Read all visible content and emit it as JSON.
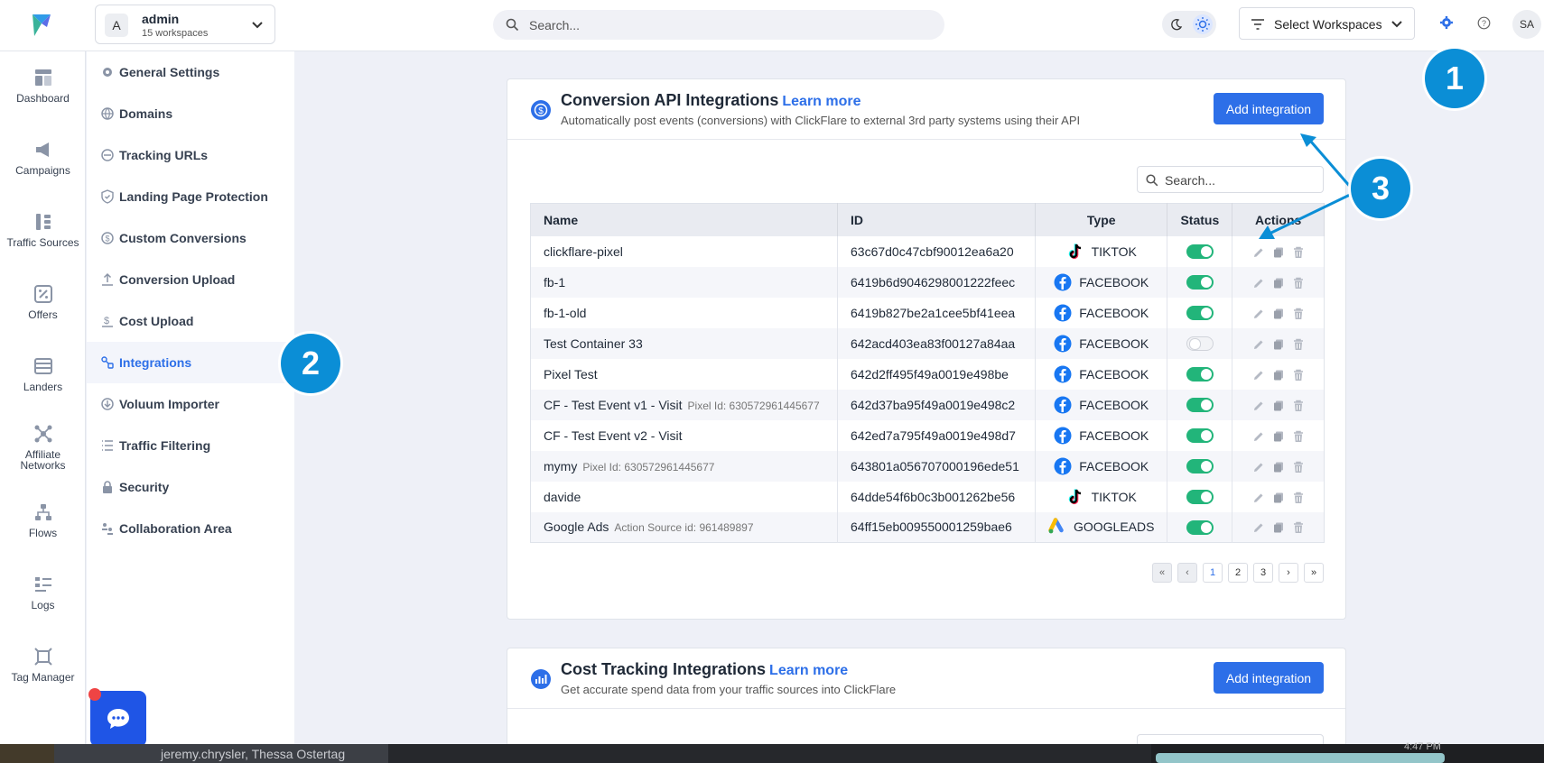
{
  "topbar": {
    "workspace": {
      "avatar": "A",
      "name": "admin",
      "sub": "15 workspaces"
    },
    "search_placeholder": "Search...",
    "select_workspaces_label": "Select Workspaces",
    "user_initials": "SA"
  },
  "leftnav": {
    "items": [
      {
        "label": "Dashboard",
        "icon": "dashboard-icon"
      },
      {
        "label": "Campaigns",
        "icon": "megaphone-icon"
      },
      {
        "label": "Traffic Sources",
        "icon": "traffic-sources-icon"
      },
      {
        "label": "Offers",
        "icon": "offers-icon"
      },
      {
        "label": "Landers",
        "icon": "landers-icon"
      },
      {
        "label": "Affiliate",
        "label2": "Networks",
        "icon": "network-icon"
      },
      {
        "label": "Flows",
        "icon": "flows-icon"
      },
      {
        "label": "Logs",
        "icon": "logs-icon"
      },
      {
        "label": "Tag Manager",
        "icon": "tag-manager-icon"
      }
    ]
  },
  "settings_menu": {
    "items": [
      {
        "label": "General Settings"
      },
      {
        "label": "Domains"
      },
      {
        "label": "Tracking URLs"
      },
      {
        "label": "Landing Page Protection"
      },
      {
        "label": "Custom Conversions"
      },
      {
        "label": "Conversion Upload"
      },
      {
        "label": "Cost Upload"
      },
      {
        "label": "Integrations",
        "active": true
      },
      {
        "label": "Voluum Importer"
      },
      {
        "label": "Traffic Filtering"
      },
      {
        "label": "Security"
      },
      {
        "label": "Collaboration Area"
      }
    ]
  },
  "conversion_card": {
    "title": "Conversion API Integrations",
    "learn_more": "Learn more",
    "subtitle": "Automatically post events (conversions) with ClickFlare to external 3rd party systems using their API",
    "add_button": "Add integration",
    "search_placeholder": "Search...",
    "columns": [
      "Name",
      "ID",
      "Type",
      "Status",
      "Actions"
    ],
    "rows": [
      {
        "name": "clickflare-pixel",
        "extra": "",
        "id": "63c67d0c47cbf90012ea6a20",
        "type": "TIKTOK",
        "status": "on"
      },
      {
        "name": "fb-1",
        "extra": "",
        "id": "6419b6d9046298001222feec",
        "type": "FACEBOOK",
        "status": "on"
      },
      {
        "name": "fb-1-old",
        "extra": "",
        "id": "6419b827be2a1cee5bf41eea",
        "type": "FACEBOOK",
        "status": "on"
      },
      {
        "name": "Test Container 33",
        "extra": "",
        "id": "642acd403ea83f00127a84aa",
        "type": "FACEBOOK",
        "status": "off"
      },
      {
        "name": "Pixel Test",
        "extra": "",
        "id": "642d2ff495f49a0019e498be",
        "type": "FACEBOOK",
        "status": "on"
      },
      {
        "name": "CF - Test Event v1 - Visit",
        "extra": "Pixel Id: 630572961445677",
        "id": "642d37ba95f49a0019e498c2",
        "type": "FACEBOOK",
        "status": "on"
      },
      {
        "name": "CF - Test Event v2 - Visit",
        "extra": "",
        "id": "642ed7a795f49a0019e498d7",
        "type": "FACEBOOK",
        "status": "on"
      },
      {
        "name": "mymy",
        "extra": "Pixel Id: 630572961445677",
        "id": "643801a056707000196ede51",
        "type": "FACEBOOK",
        "status": "on"
      },
      {
        "name": "davide",
        "extra": "",
        "id": "64dde54f6b0c3b001262be56",
        "type": "TIKTOK",
        "status": "on"
      },
      {
        "name": "Google Ads",
        "extra": "Action Source id: 961489897",
        "id": "64ff15eb009550001259bae6",
        "type": "GOOGLEADS",
        "status": "on"
      }
    ],
    "pagination": {
      "first": "«",
      "prev": "‹",
      "pages": [
        "1",
        "2",
        "3"
      ],
      "current": "1",
      "next": "›",
      "last": "»"
    }
  },
  "cost_card": {
    "title": "Cost Tracking Integrations",
    "learn_more": "Learn more",
    "subtitle": "Get accurate spend data from your traffic sources into ClickFlare",
    "add_button": "Add integration"
  },
  "annotations": {
    "m1": "1",
    "m2": "2",
    "m3": "3"
  },
  "taskbar": {
    "people": "jeremy.chrysler, Thessa Ostertag",
    "time": "4:47 PM"
  },
  "colors": {
    "accent": "#2d6fe8",
    "toggle_on": "#22b57a",
    "marker": "#0b8ed6"
  }
}
